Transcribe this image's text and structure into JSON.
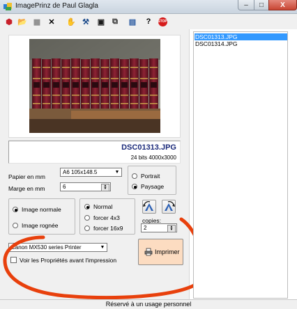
{
  "window": {
    "title": "ImagePrinz de Paul Glagla",
    "controls": {
      "minimize": "–",
      "maximize": "□",
      "close": "X"
    }
  },
  "toolbar": {
    "buttons": [
      {
        "name": "select-icon",
        "glyph": "⬢",
        "color": "#c8202a"
      },
      {
        "name": "open-folder-icon",
        "glyph": "📂",
        "color": "#d9a400"
      },
      {
        "name": "gallery-icon",
        "glyph": "▦",
        "color": "#8a8a8a"
      },
      {
        "name": "cut-icon",
        "glyph": "✕",
        "color": "#000000"
      },
      {
        "name": "hand-icon",
        "glyph": "✋",
        "color": "#4a6b2c"
      },
      {
        "name": "brush-icon",
        "glyph": "⚒",
        "color": "#1b4a8a"
      },
      {
        "name": "save-icon",
        "glyph": "▣",
        "color": "#1a1a1a"
      },
      {
        "name": "copy-icon",
        "glyph": "⧉",
        "color": "#333333"
      },
      {
        "name": "properties-icon",
        "glyph": "▤",
        "color": "#2a5aa0"
      },
      {
        "name": "help-icon",
        "glyph": "?",
        "color": "#000000"
      },
      {
        "name": "stop-icon",
        "glyph": "STOP",
        "color": "#d61c1c"
      }
    ]
  },
  "file": {
    "name": "DSC01313.JPG",
    "details": "24 bits 4000x3000"
  },
  "paper": {
    "label": "Papier en mm",
    "value": "A6 105x148.5"
  },
  "margin": {
    "label": "Marge en mm",
    "value": "6"
  },
  "orientation": {
    "options": [
      {
        "label": "Portrait",
        "selected": false
      },
      {
        "label": "Paysage",
        "selected": true
      }
    ]
  },
  "image_mode": {
    "options": [
      {
        "label": "Image normale",
        "selected": true
      },
      {
        "label": "Image rognée",
        "selected": false
      }
    ]
  },
  "ratio": {
    "options": [
      {
        "label": "Normal",
        "selected": true
      },
      {
        "label": "forcer 4x3",
        "selected": false
      },
      {
        "label": "forcer 16x9",
        "selected": false
      }
    ]
  },
  "copies": {
    "label": "copies:",
    "value": "2"
  },
  "printer": {
    "value": "Canon MX530 series Printer",
    "properties_checkbox": "Voir les Propriétés avant l'impression"
  },
  "print_button": {
    "label": "Imprimer",
    "color": "#fcdcc1"
  },
  "file_list": {
    "items": [
      {
        "label": "DSC01313.JPG",
        "selected": true
      },
      {
        "label": "DSC01314.JPG",
        "selected": false
      }
    ],
    "selection_color": "#3399ff"
  },
  "status": {
    "text": "Réservé à un usage personnel"
  },
  "annotation": {
    "color": "#e8400c"
  }
}
